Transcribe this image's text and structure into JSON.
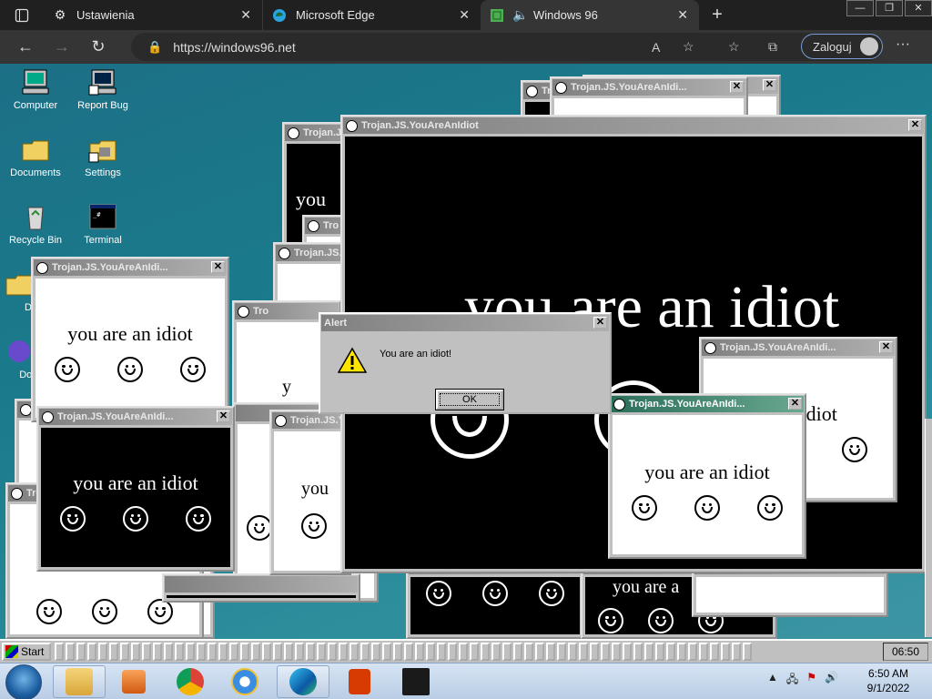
{
  "browser": {
    "tabs": [
      {
        "label": "Ustawienia",
        "icon": "gear-icon"
      },
      {
        "label": "Microsoft Edge",
        "icon": "edge-icon"
      },
      {
        "label": "Windows 96",
        "icon": "windows96-icon",
        "active": true
      }
    ],
    "address": "https://windows96.net",
    "login_label": "Zaloguj"
  },
  "desktop_icons": [
    {
      "label": "Computer",
      "icon": "computer-icon"
    },
    {
      "label": "Report Bug",
      "icon": "report-bug-icon"
    },
    {
      "label": "Documents",
      "icon": "documents-folder-icon"
    },
    {
      "label": "Settings",
      "icon": "settings-folder-icon"
    },
    {
      "label": "Recycle Bin",
      "icon": "recycle-bin-icon"
    },
    {
      "label": "Terminal",
      "icon": "terminal-icon"
    },
    {
      "label": "D",
      "icon": "folder-icon"
    },
    {
      "label": "Doc",
      "icon": "document-icon"
    }
  ],
  "trojan_title": "Trojan.JS.YouAreAnIdiot",
  "trojan_title_short": "Trojan.JS.YouAreAnIdi...",
  "trojan_title_tiny": "Tro",
  "idiot_message": "you are an idiot",
  "idiot_partial_1": "you",
  "idiot_partial_2": "you a",
  "idiot_partial_3": "you are a",
  "idiot_partial_4": "are a",
  "idiot_partial_5": "n idiot",
  "idiot_partial_6": "y",
  "alert": {
    "title": "Alert",
    "message": "You are an idiot!",
    "ok_label": "OK"
  },
  "w96_taskbar": {
    "start_label": "Start",
    "clock": "06:50"
  },
  "win7_taskbar": {
    "time": "6:50 AM",
    "date": "9/1/2022",
    "apps": [
      "explorer-icon",
      "media-player-icon",
      "chrome-icon",
      "internet-explorer-icon",
      "edge-icon",
      "office-icon",
      "app-icon"
    ]
  }
}
